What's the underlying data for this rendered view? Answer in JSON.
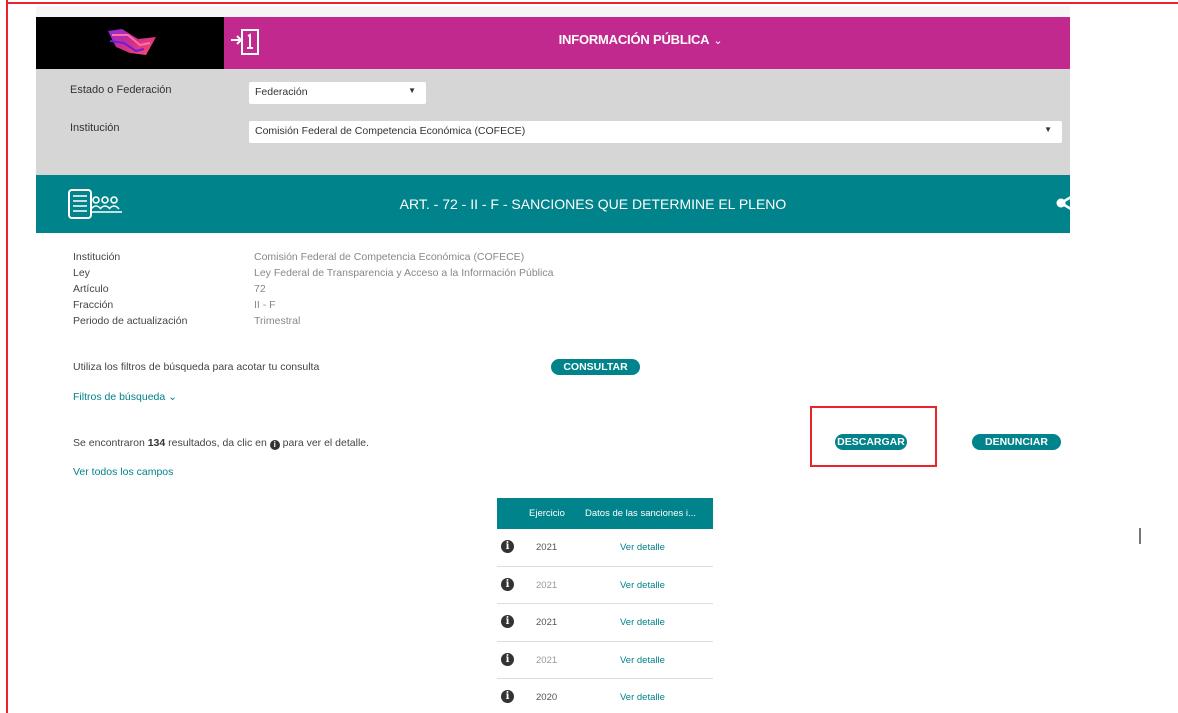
{
  "header": {
    "menu_label": "INFORMACIÓN PÚBLICA",
    "menu_chevron": "⌄",
    "icons": {
      "logo": "brand-logo",
      "login": "login-arrow-icon"
    }
  },
  "filters": {
    "estado_label": "Estado o Federación",
    "estado_value": "Federación",
    "institucion_label": "Institución",
    "institucion_value": "Comisión Federal de Competencia Económica (COFECE)"
  },
  "section": {
    "title": "ART. - 72 - II - F - SANCIONES QUE DETERMINE EL PLENO",
    "icons": {
      "doc": "document-people-icon",
      "share": "share-icon"
    }
  },
  "details": [
    {
      "key": "Institución",
      "value": "Comisión Federal de Competencia Económica (COFECE)"
    },
    {
      "key": "Ley",
      "value": "Ley Federal de Transparencia y Acceso a la Información Pública"
    },
    {
      "key": "Artículo",
      "value": "72"
    },
    {
      "key": "Fracción",
      "value": "II - F"
    },
    {
      "key": "Periodo de actualización",
      "value": "Trimestral"
    }
  ],
  "search": {
    "hint": "Utiliza los filtros de búsqueda para acotar tu consulta",
    "consultar": "CONSULTAR",
    "filtros": "Filtros de búsqueda",
    "filtros_chevron": "⌄"
  },
  "results": {
    "prefix": "Se encontraron ",
    "count": "134",
    "middle": " resultados, da clic en ",
    "info_glyph": "i",
    "suffix": " para ver el detalle.",
    "ver_todos": "Ver todos los campos",
    "descargar": "DESCARGAR",
    "denunciar": "DENUNCIAR"
  },
  "table": {
    "headers": [
      "Ejercicio",
      "Datos de las sanciones i..."
    ],
    "rows": [
      {
        "year": "2021",
        "link": "Ver detalle"
      },
      {
        "year": "2021",
        "link": "Ver detalle"
      },
      {
        "year": "2021",
        "link": "Ver detalle"
      },
      {
        "year": "2021",
        "link": "Ver detalle"
      },
      {
        "year": "2020",
        "link": "Ver detalle"
      }
    ],
    "row_icon": "i"
  },
  "colors": {
    "magenta": "#c2298f",
    "teal": "#00838a",
    "panel": "#d6d6d6",
    "highlight": "#e8252b"
  }
}
